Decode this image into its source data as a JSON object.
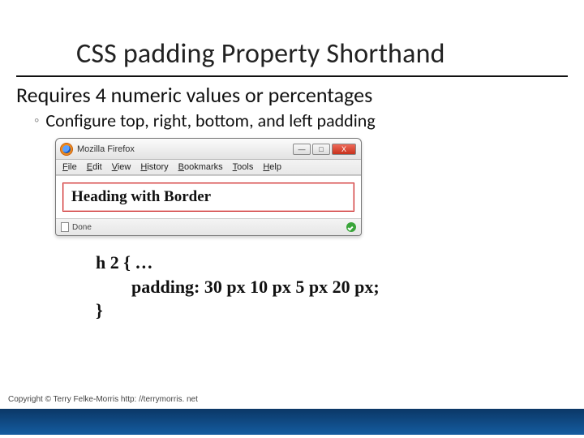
{
  "slide": {
    "title": "CSS padding Property Shorthand",
    "subtitle": "Requires 4 numeric values or percentages",
    "sub_bullet": "Configure top, right, bottom, and left padding"
  },
  "browser": {
    "app": "Mozilla Firefox",
    "menus": {
      "file": "File",
      "edit": "Edit",
      "view": "View",
      "history": "History",
      "bookmarks": "Bookmarks",
      "tools": "Tools",
      "help": "Help"
    },
    "heading": "Heading with Border",
    "status": "Done",
    "min": "—",
    "max": "□",
    "close": "X"
  },
  "code": {
    "line1": "h 2 { …",
    "line2": "        padding: 30 px 10 px 5 px 20 px;",
    "line3": "}"
  },
  "footer": {
    "copyright": "Copyright © Terry Felke-Morris http: //terrymorris. net"
  }
}
